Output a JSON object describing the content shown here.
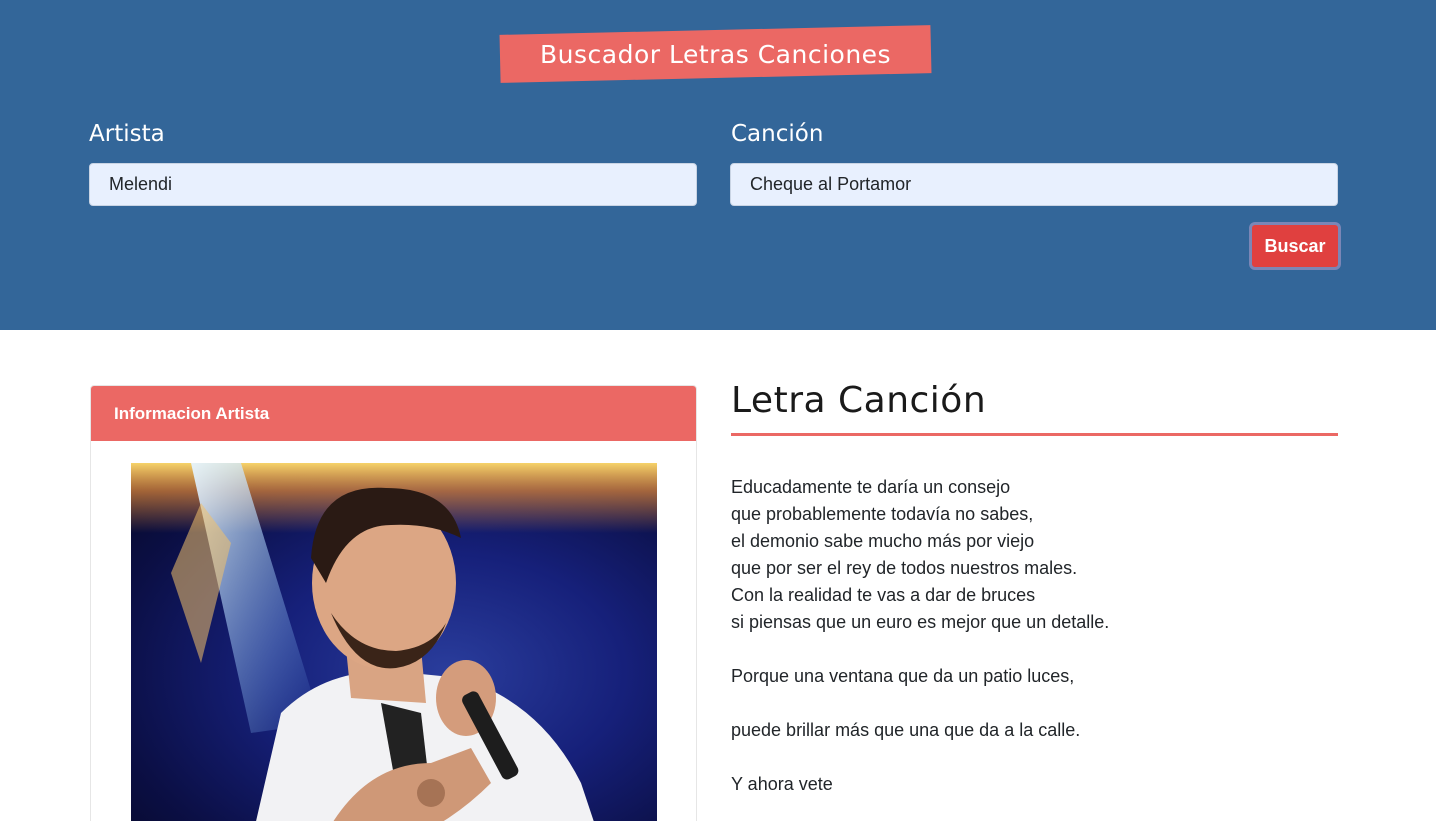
{
  "header": {
    "title": "Buscador Letras Canciones",
    "artist_label": "Artista",
    "artist_value": "Melendi",
    "song_label": "Canción",
    "song_value": "Cheque al Portamor",
    "search_button": "Buscar"
  },
  "artist_card": {
    "header": "Informacion Artista"
  },
  "lyrics": {
    "title": "Letra Canción",
    "lines": [
      "Educadamente te daría un consejo",
      "que probablemente todavía no sabes,",
      "el demonio sabe mucho más por viejo",
      "que por ser el rey de todos nuestros males.",
      "Con la realidad te vas a dar de bruces",
      "si piensas que un euro es mejor que un detalle.",
      "Porque una ventana que da un patio luces,",
      "puede brillar más que una que da a la calle.",
      "Y ahora vete"
    ]
  },
  "colors": {
    "header_bg": "#336699",
    "accent": "#eb6864",
    "button": "#e0403f",
    "input_bg": "#e8f0fe"
  }
}
